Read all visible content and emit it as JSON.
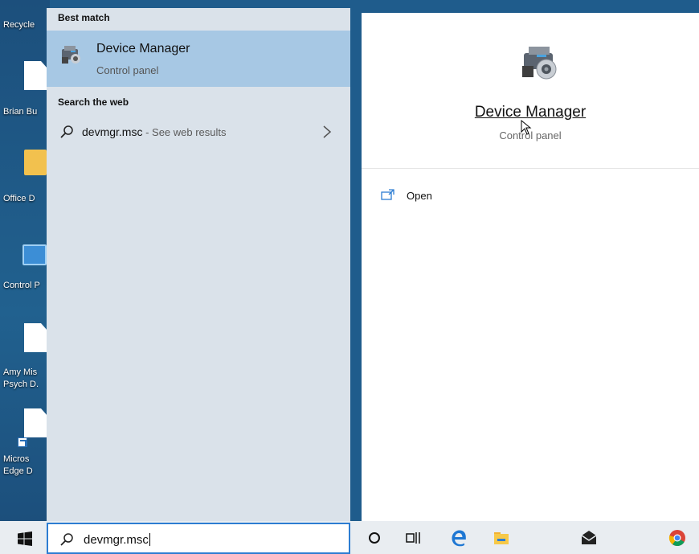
{
  "desktop": {
    "items": [
      {
        "label": "Recycle",
        "icon": "recycle-bin-icon"
      },
      {
        "label": "Brian Bu",
        "icon": "document-icon"
      },
      {
        "label": "Office D",
        "icon": "folder-icon"
      },
      {
        "label": "Control P",
        "icon": "control-panel-icon"
      },
      {
        "label": "Amy Mis",
        "label2": "Psych D.",
        "icon": "document-icon"
      },
      {
        "label": "Micros",
        "label2": "Edge D",
        "icon": "shortcut-document-icon"
      }
    ]
  },
  "search_results": {
    "best_match_header": "Best match",
    "best_match": {
      "title": "Device Manager",
      "subtitle": "Control panel",
      "icon": "device-manager-icon"
    },
    "web_header": "Search the web",
    "web_item": {
      "query": "devmgr.msc",
      "suffix": " - See web results",
      "icon": "search-icon"
    }
  },
  "preview": {
    "title": "Device Manager",
    "subtitle": "Control panel",
    "icon": "device-manager-icon",
    "actions": [
      {
        "label": "Open",
        "icon": "open-icon"
      }
    ]
  },
  "taskbar": {
    "search_value": "devmgr.msc",
    "icons": [
      "start-icon",
      "cortana-icon",
      "task-view-icon",
      "edge-icon",
      "file-explorer-icon",
      "mail-icon",
      "chrome-icon"
    ]
  },
  "colors": {
    "selected_row": "#a7c8e4",
    "left_pane_bg": "#dae2ea",
    "search_border": "#2d7dd2",
    "taskbar_bg": "#e9edf1"
  }
}
